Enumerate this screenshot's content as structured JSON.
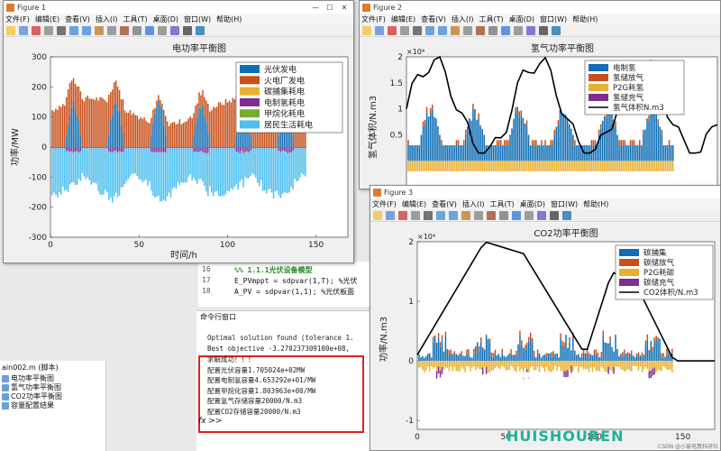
{
  "fig1": {
    "title": "Figure 1",
    "menus": [
      "文件(F)",
      "编辑(E)",
      "查看(V)",
      "插入(I)",
      "工具(T)",
      "桌面(D)",
      "窗口(W)",
      "帮助(H)"
    ],
    "axes_title": "电功率平衡图",
    "xlabel": "时间/h",
    "ylabel": "功率/MW",
    "yticks": [
      "300",
      "200",
      "100",
      "0",
      "-100",
      "-200",
      "-300"
    ],
    "xticks": [
      "0",
      "50",
      "100",
      "150"
    ],
    "legend": [
      {
        "label": "光伏发电",
        "color": "#0f6eb4"
      },
      {
        "label": "火电厂发电",
        "color": "#c8501a"
      },
      {
        "label": "碳捕集耗电",
        "color": "#e8b030"
      },
      {
        "label": "电制氢耗电",
        "color": "#7e2e8e"
      },
      {
        "label": "甲烷化耗电",
        "color": "#77ac30"
      },
      {
        "label": "居民生活耗电",
        "color": "#4dbeee"
      }
    ]
  },
  "fig2": {
    "title": "Figure 2",
    "menus": [
      "文件(F)",
      "编辑(E)",
      "查看(V)",
      "插入(I)",
      "工具(T)",
      "桌面(D)",
      "窗口(W)",
      "帮助(H)"
    ],
    "axes_title": "氢气功率平衡图",
    "ylabel": "氢气体积/N.m3",
    "exponent": "×10⁴",
    "yticks": [
      "2",
      "1.5",
      "1",
      "0.5"
    ],
    "legend": [
      {
        "label": "电制氢",
        "color": "#0f6eb4"
      },
      {
        "label": "氢储放气",
        "color": "#c8501a"
      },
      {
        "label": "P2G耗氢",
        "color": "#e8b030"
      },
      {
        "label": "氢储充气",
        "color": "#7e2e8e"
      },
      {
        "label": "氢气体积N.m3",
        "color": "#000000"
      }
    ]
  },
  "fig3": {
    "title": "Figure 3",
    "menus": [
      "文件(F)",
      "编辑(E)",
      "查看(V)",
      "插入(I)",
      "工具(T)",
      "桌面(D)",
      "窗口(W)",
      "帮助(H)"
    ],
    "axes_title": "CO2功率平衡图",
    "ylabel": "功率/N.m3",
    "exponent": "×10⁴",
    "yticks": [
      "2",
      "1",
      "0",
      "-1"
    ],
    "xticks": [
      "0",
      "50",
      "100",
      "150"
    ],
    "legend": [
      {
        "label": "碳捕集",
        "color": "#0f6eb4"
      },
      {
        "label": "碳储放气",
        "color": "#c8501a"
      },
      {
        "label": "P2G耗碳",
        "color": "#e8b030"
      },
      {
        "label": "碳储充气",
        "color": "#7e2e8e"
      },
      {
        "label": "CO2体积/N.m3",
        "color": "#000000"
      }
    ]
  },
  "editor": {
    "lines": [
      {
        "num": "16",
        "text": "%% 1.1.1光伏设备模型"
      },
      {
        "num": "17",
        "text": "E_PVmppt = sdpvar(1,T);  %光伏"
      },
      {
        "num": "18",
        "text": "A_PV = sdpvar(1,1);  %光伏板面"
      }
    ]
  },
  "command_window": {
    "header": "命令行窗口",
    "lines": [
      "Optimal solution found (tolerance 1.",
      "Best objective -3.270237309100e+08,",
      "求解成功！！！",
      "配置光伏容量1.705024e+02MW",
      "配置电制氢容量4.653292e+01/MW",
      "配置甲烷化容量1.803963e+00/MW",
      "配置氢气存储容量20000/N.m3",
      "配置CO2存储容量20000/N.m3"
    ],
    "prompt": "fx >>"
  },
  "left_panel": {
    "header": "ain002.m  (脚本)",
    "items": [
      "电功率平衡图",
      "氢气功率平衡图",
      "CO2功率平衡图",
      "容量配置结果"
    ]
  },
  "watermark": {
    "logo": "回收人",
    "text": "HUISHOUREN",
    "credit": "CSDN @小易电算科研社"
  }
}
